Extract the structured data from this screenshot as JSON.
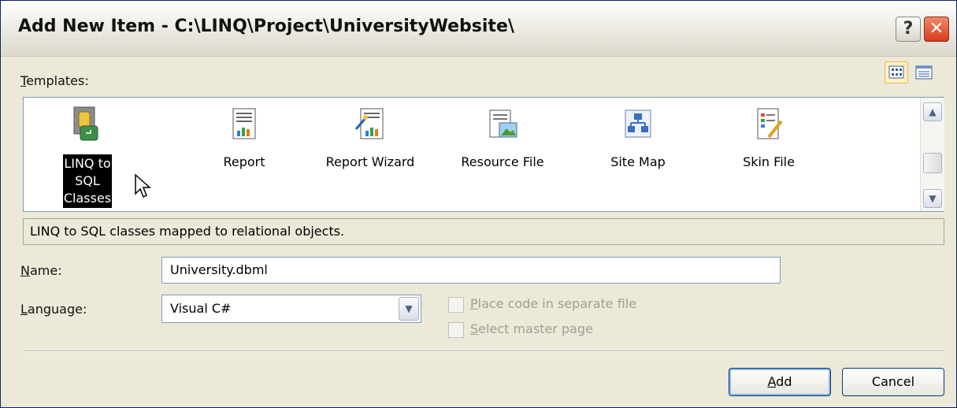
{
  "window": {
    "title": "Add New Item - C:\\LINQ\\Project\\UniversityWebsite\\"
  },
  "title_buttons": {
    "help": "?",
    "close": "✕"
  },
  "view_toggle": {
    "large_icons_icon": "large-icons-view-icon",
    "small_icons_icon": "small-icons-view-icon"
  },
  "templates": {
    "label_mnemonic": "T",
    "label_rest": "emplates:",
    "items": [
      {
        "label": "LINQ to SQL Classes",
        "icon": "linq-to-sql-icon",
        "selected": true
      },
      {
        "label": "Report",
        "icon": "report-icon"
      },
      {
        "label": "Report Wizard",
        "icon": "report-wizard-icon"
      },
      {
        "label": "Resource File",
        "icon": "resource-file-icon"
      },
      {
        "label": "Site Map",
        "icon": "site-map-icon"
      },
      {
        "label": "Skin File",
        "icon": "skin-file-icon"
      }
    ]
  },
  "description": "LINQ to SQL classes mapped to relational objects.",
  "name_field": {
    "label_mnemonic": "N",
    "label_rest": "ame:",
    "value": "University.dbml"
  },
  "language_field": {
    "label_mnemonic": "L",
    "label_rest": "anguage:",
    "value": "Visual C#"
  },
  "options": {
    "place_code": {
      "mnemonic": "P",
      "rest": "lace code in separate file",
      "checked": false,
      "enabled": false
    },
    "master_page": {
      "mnemonic": "S",
      "rest": "elect master page",
      "checked": false,
      "enabled": false
    }
  },
  "buttons": {
    "add_mnemonic": "A",
    "add_rest": "dd",
    "cancel": "Cancel"
  }
}
